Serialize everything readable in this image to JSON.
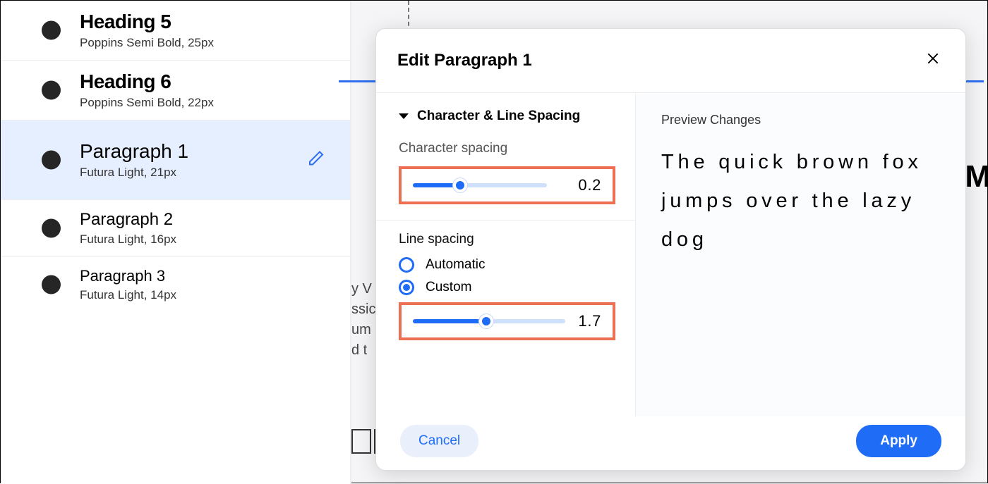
{
  "styles": [
    {
      "name": "Heading 5",
      "desc": "Poppins Semi Bold, 25px",
      "kind": "heading"
    },
    {
      "name": "Heading 6",
      "desc": "Poppins Semi Bold, 22px",
      "kind": "heading"
    },
    {
      "name": "Paragraph 1",
      "desc": "Futura Light, 21px",
      "kind": "para",
      "selected": true
    },
    {
      "name": "Paragraph 2",
      "desc": "Futura Light, 16px",
      "kind": "para"
    },
    {
      "name": "Paragraph 3",
      "desc": "Futura Light, 14px",
      "kind": "para"
    }
  ],
  "modal": {
    "title": "Edit Paragraph 1",
    "section": "Character & Line Spacing",
    "char_spacing": {
      "label": "Character spacing",
      "value": "0.2",
      "percent": 35
    },
    "line_spacing": {
      "label": "Line spacing",
      "options": {
        "automatic": "Automatic",
        "custom": "Custom"
      },
      "selected": "custom",
      "value": "1.7",
      "percent": 48
    },
    "preview": {
      "title": "Preview Changes",
      "text": "The quick brown fox jumps over the lazy dog"
    },
    "buttons": {
      "cancel": "Cancel",
      "apply": "Apply"
    }
  },
  "background": {
    "snippet_lines": [
      "y V",
      "ssic",
      "um",
      "d t"
    ],
    "big_letter": "M"
  }
}
